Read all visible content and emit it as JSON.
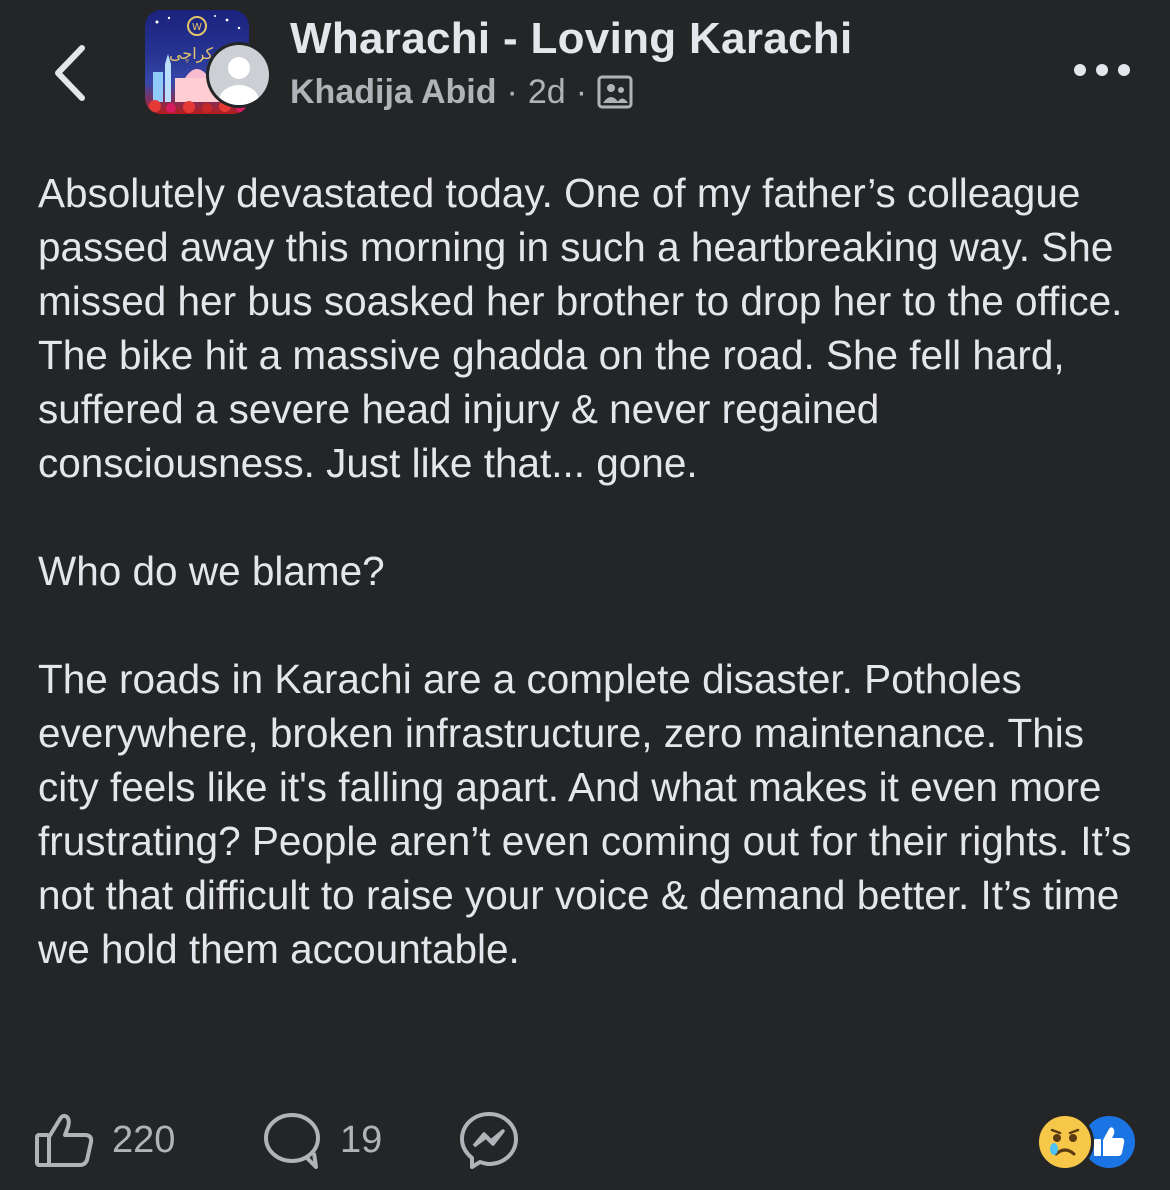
{
  "header": {
    "group_name": "Wharachi - Loving Karachi",
    "author": "Khadija Abid",
    "separator": "·",
    "time": "2d",
    "audience_icon": "group-audience-icon",
    "back_icon": "chevron-left-icon",
    "more_icon": "more-dots-icon",
    "group_logo_text": "کراچی"
  },
  "post": {
    "paragraphs": [
      "Absolutely devastated today. One of my father’s colleague passed away this morning in such a heartbreaking way. She missed her bus soasked her brother to drop her to the office. The bike hit a massive ghadda on the road. She fell hard, suffered a severe head injury & never regained consciousness. Just like that... gone.",
      "Who do we blame?",
      "The roads in Karachi are a complete disaster. Potholes everywhere, broken infrastructure, zero maintenance. This city feels like it's falling apart. And what makes it even more frustrating? People aren’t even coming out for their rights. It’s not that difficult to raise your voice & demand better. It’s time we hold them accountable."
    ]
  },
  "actions": {
    "like_count": "220",
    "comment_count": "19",
    "like_icon": "thumbs-up-icon",
    "comment_icon": "comment-bubble-icon",
    "share_icon": "messenger-icon"
  },
  "reactions": {
    "sad_icon": "sad-reaction-icon",
    "like_icon": "like-reaction-icon",
    "sad_color": "#f7c74a",
    "like_color": "#1b74e4"
  },
  "colors": {
    "background": "#242526",
    "primary_text": "#e4e6eb",
    "secondary_text": "#b0b3b8"
  }
}
